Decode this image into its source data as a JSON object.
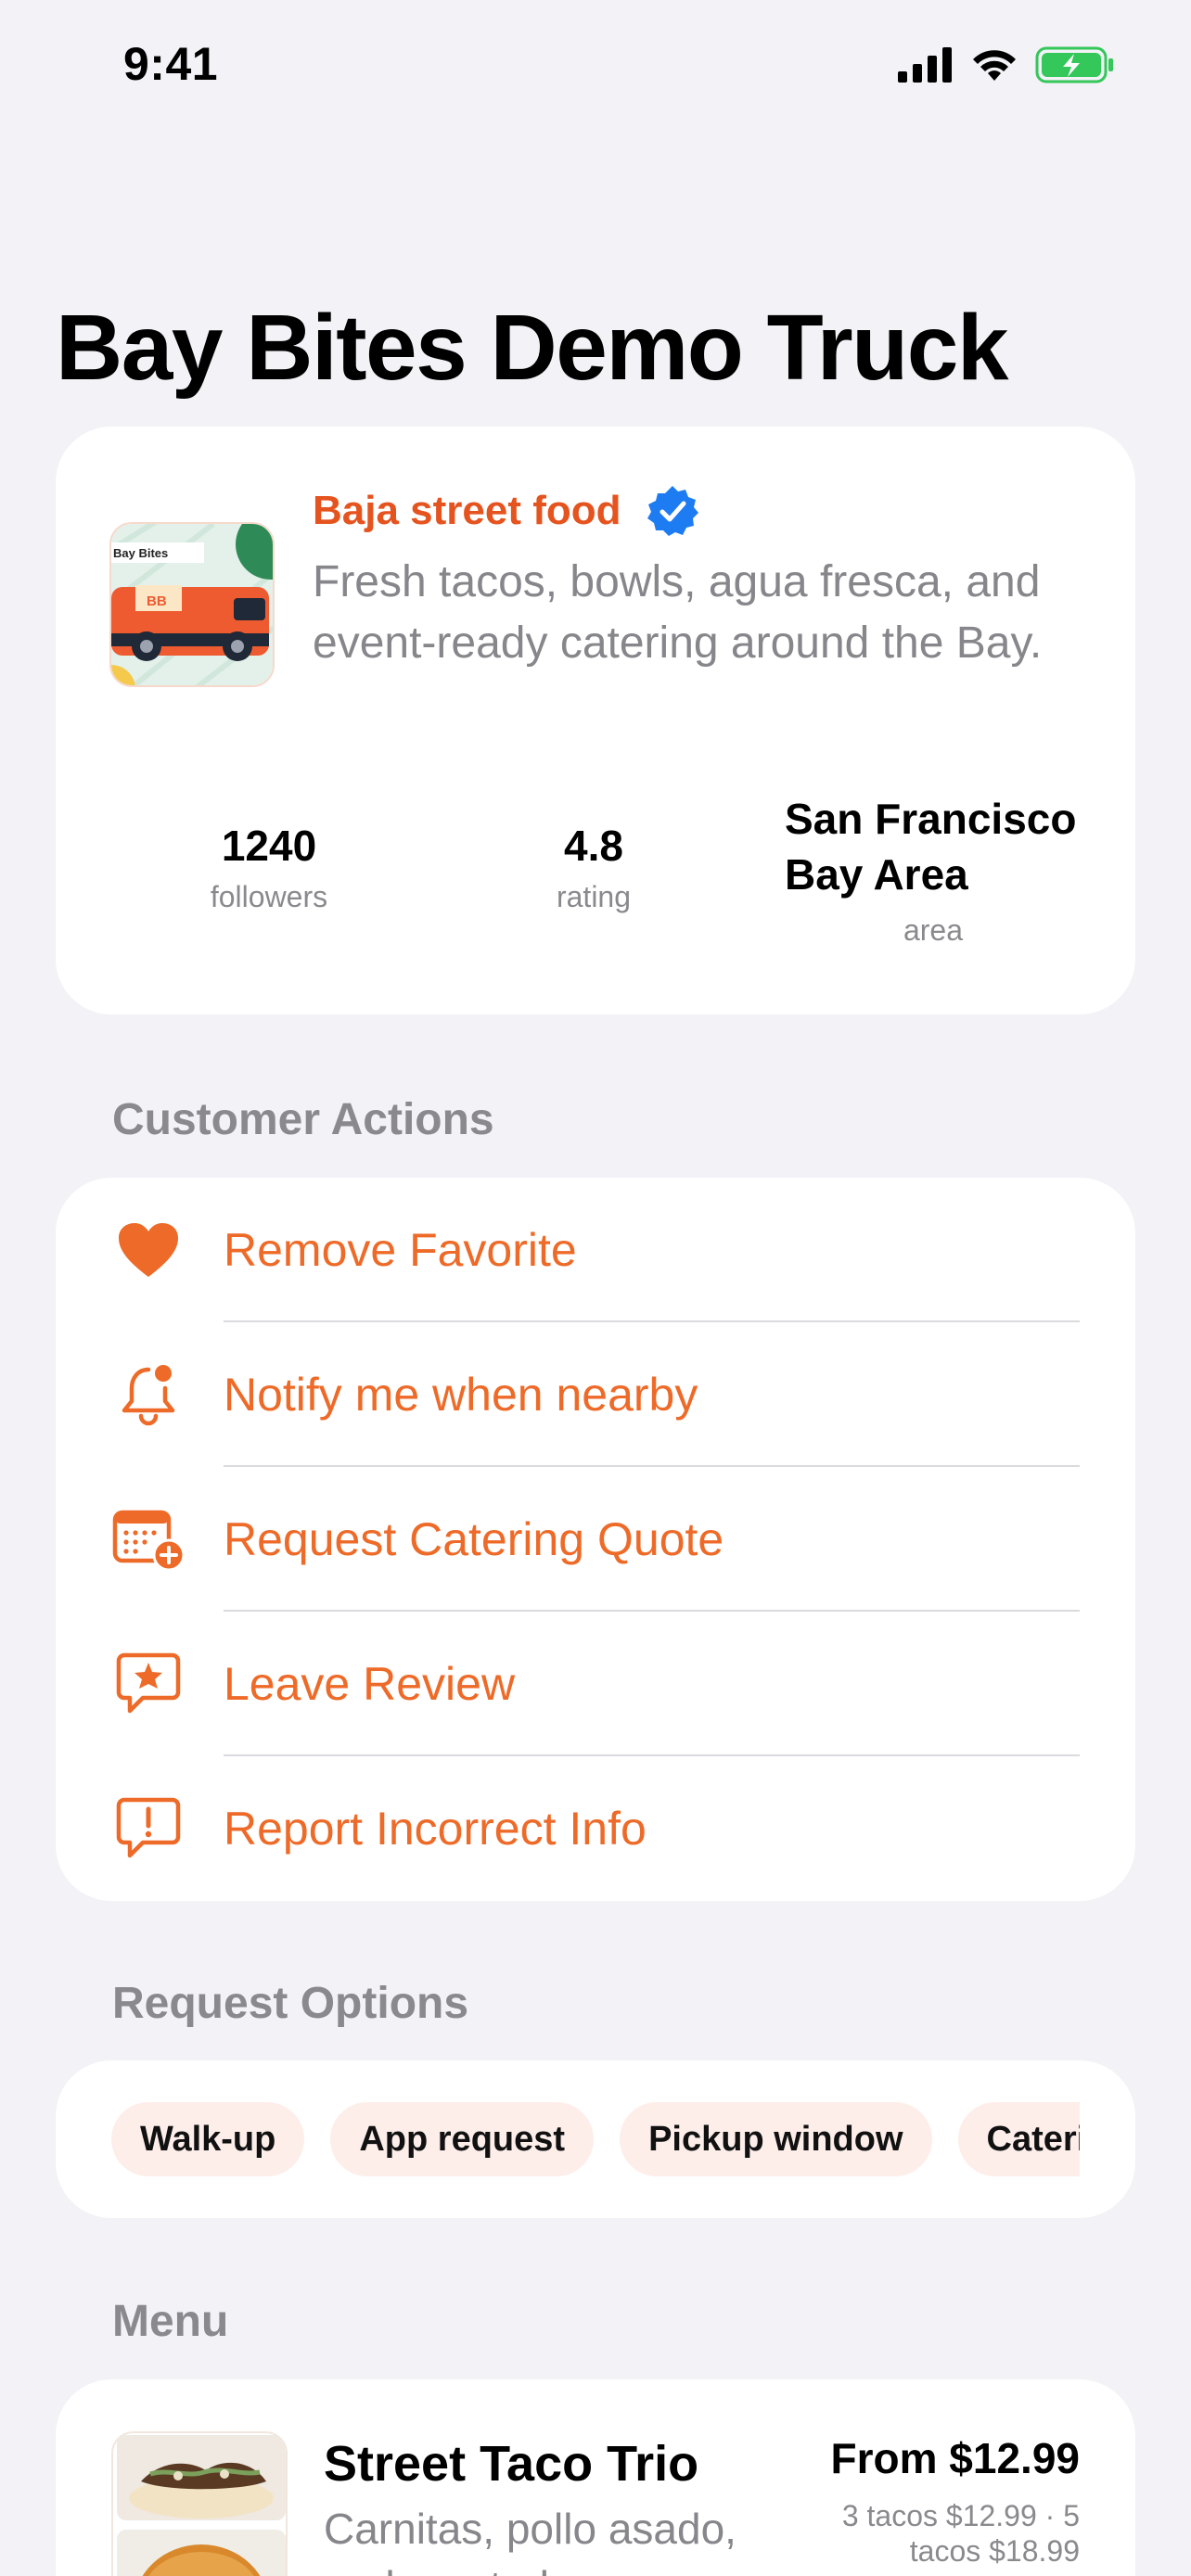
{
  "status_bar": {
    "time": "9:41"
  },
  "page": {
    "title": "Bay Bites Demo Truck"
  },
  "profile": {
    "thumb_text": "Bay Bites",
    "thumb_badge": "BB",
    "category": "Baja street food",
    "description": "Fresh tacos, bowls, agua fresca, and event-ready catering around the Bay.",
    "stats": {
      "followers": {
        "value": "1240",
        "label": "followers"
      },
      "rating": {
        "value": "4.8",
        "label": "rating"
      },
      "area": {
        "value": "San Francisco Bay Area",
        "label": "area"
      }
    }
  },
  "customer_actions": {
    "header": "Customer Actions",
    "items": [
      {
        "label": "Remove Favorite",
        "icon": "heart-icon"
      },
      {
        "label": "Notify me when nearby",
        "icon": "bell-icon"
      },
      {
        "label": "Request Catering Quote",
        "icon": "calendar-plus-icon"
      },
      {
        "label": "Leave Review",
        "icon": "star-bubble-icon"
      },
      {
        "label": "Report Incorrect Info",
        "icon": "exclamation-bubble-icon"
      }
    ]
  },
  "request_options": {
    "header": "Request Options",
    "chips": [
      "Walk-up",
      "App request",
      "Pickup window",
      "Catering"
    ]
  },
  "menu": {
    "header": "Menu",
    "items": [
      {
        "name": "Street Taco Trio",
        "description": "Carnitas, pollo asado, and roasted",
        "price": "From $12.99",
        "price_detail": "3 tacos $12.99 · 5 tacos $18.99"
      }
    ]
  },
  "colors": {
    "accent": "#EE6A28",
    "category": "#E5531F",
    "verified": "#1E7CF2",
    "background": "#F2F2F7",
    "chip_bg": "#FDEEEA",
    "battery": "#34C759"
  }
}
